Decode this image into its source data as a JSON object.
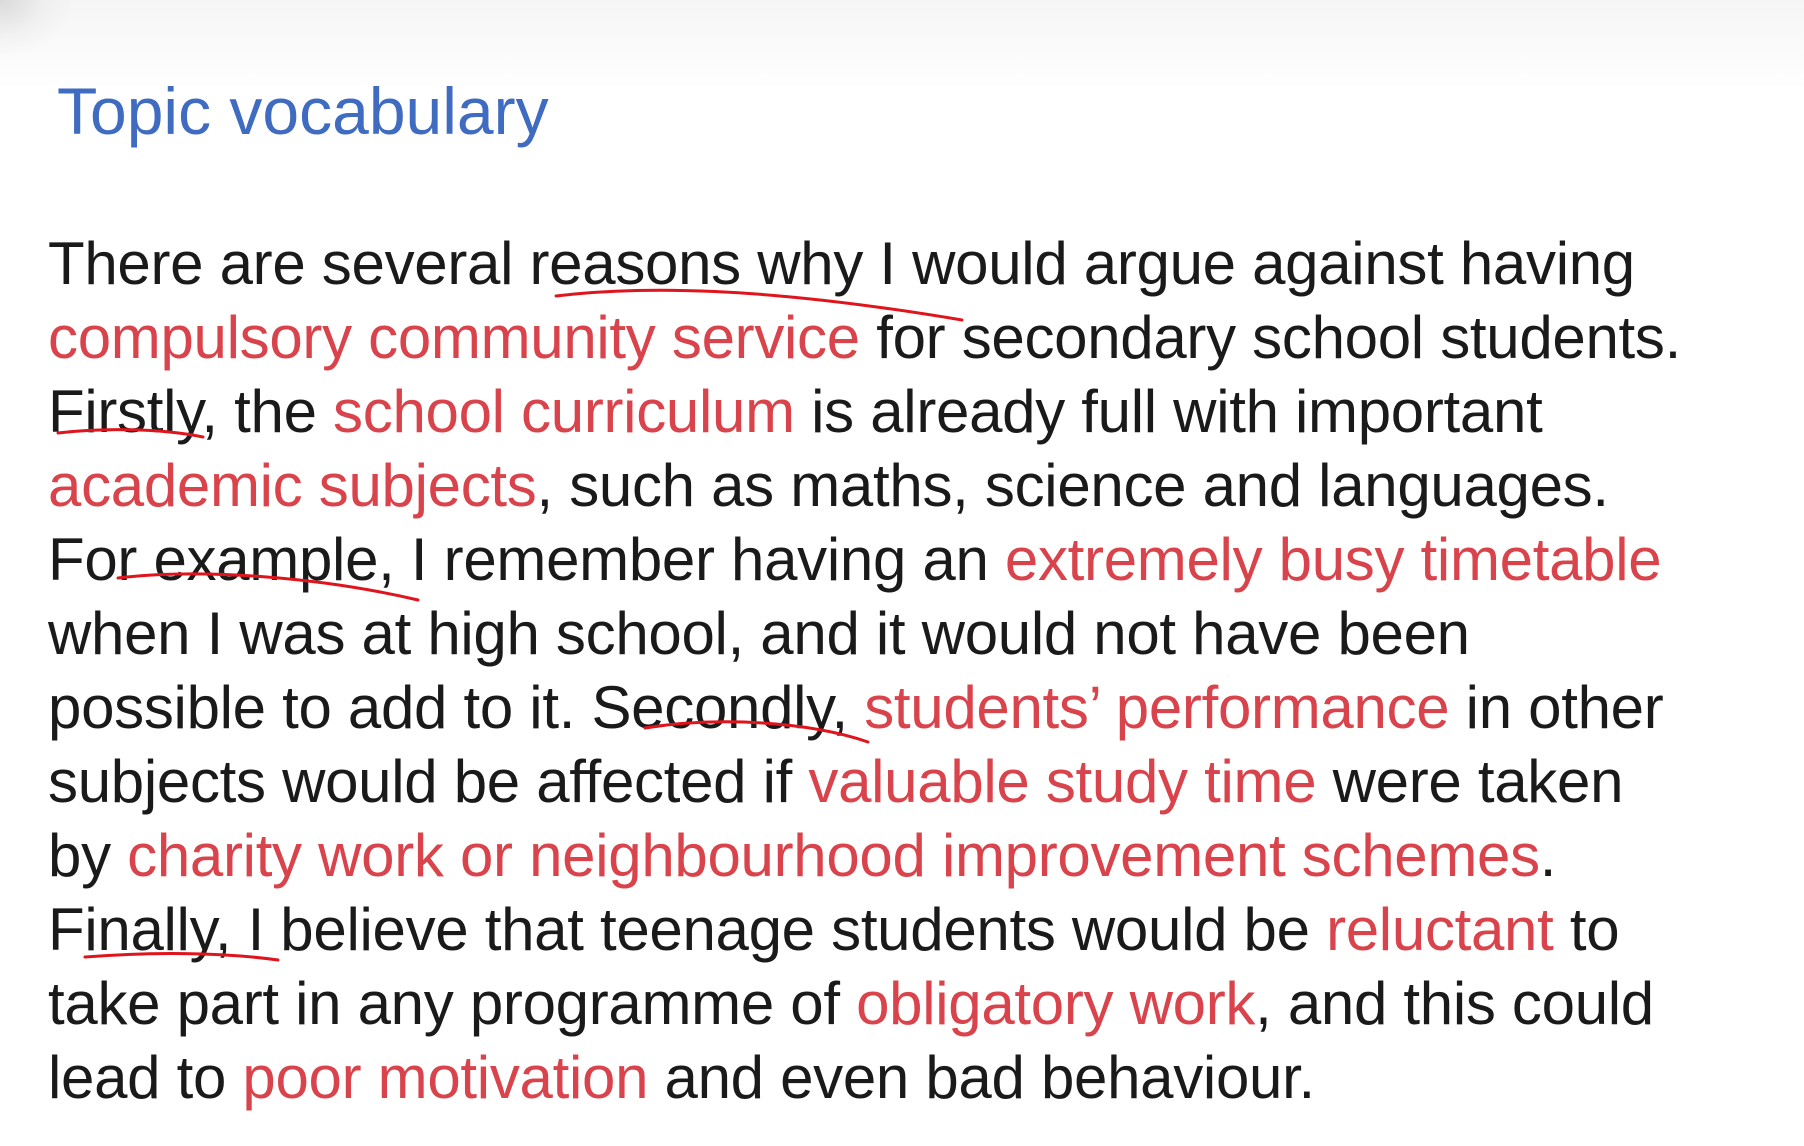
{
  "title": "Topic vocabulary",
  "colors": {
    "title": "#3f6bc0",
    "body_text": "#1a1a1a",
    "vocabulary_term": "#d9434b",
    "pen_annotation": "#e0141c"
  },
  "passage": {
    "lines": [
      [
        {
          "text": "There are several ",
          "term": false
        },
        {
          "text": "reasons",
          "term": false
        },
        {
          "text": " why I would argue against having",
          "term": false
        }
      ],
      [
        {
          "text": "compulsory community service",
          "term": true
        },
        {
          "text": " for secondary school students.",
          "term": false
        }
      ],
      [
        {
          "text": "Firstly",
          "term": false
        },
        {
          "text": ", the ",
          "term": false
        },
        {
          "text": "school curriculum",
          "term": true
        },
        {
          "text": " is already full with important",
          "term": false
        }
      ],
      [
        {
          "text": "academic subjects",
          "term": true
        },
        {
          "text": ", such as maths, science and languages.",
          "term": false
        }
      ],
      [
        {
          "text": "For example",
          "term": false
        },
        {
          "text": ", I remember having an ",
          "term": false
        },
        {
          "text": "extremely busy timetable",
          "term": true
        }
      ],
      [
        {
          "text": "when I was at high school, and it would not have been",
          "term": false
        }
      ],
      [
        {
          "text": "possible to add to it. ",
          "term": false
        },
        {
          "text": "Secondly",
          "term": false
        },
        {
          "text": ", ",
          "term": false
        },
        {
          "text": "students’ performance",
          "term": true
        },
        {
          "text": " in other",
          "term": false
        }
      ],
      [
        {
          "text": "subjects would be affected if ",
          "term": false
        },
        {
          "text": "valuable study time",
          "term": true
        },
        {
          "text": " were taken",
          "term": false
        }
      ],
      [
        {
          "text": "by ",
          "term": false
        },
        {
          "text": "charity work or neighbourhood improvement schemes",
          "term": true
        },
        {
          "text": ".",
          "term": false
        }
      ],
      [
        {
          "text": "Finally, I",
          "term": false
        },
        {
          "text": " believe that teenage students would be ",
          "term": false
        },
        {
          "text": "reluctant",
          "term": true
        },
        {
          "text": " to",
          "term": false
        }
      ],
      [
        {
          "text": "take part in any programme of ",
          "term": false
        },
        {
          "text": "obligatory work",
          "term": true
        },
        {
          "text": ", and this could",
          "term": false
        }
      ],
      [
        {
          "text": "lead to ",
          "term": false
        },
        {
          "text": "poor motivation",
          "term": true
        },
        {
          "text": " and even bad behaviour.",
          "term": false
        }
      ]
    ]
  },
  "annotations": [
    {
      "marks": "reasons"
    },
    {
      "marks": "Firstly"
    },
    {
      "marks": "For example"
    },
    {
      "marks": "Secondly"
    },
    {
      "marks": "Finally, I"
    }
  ]
}
